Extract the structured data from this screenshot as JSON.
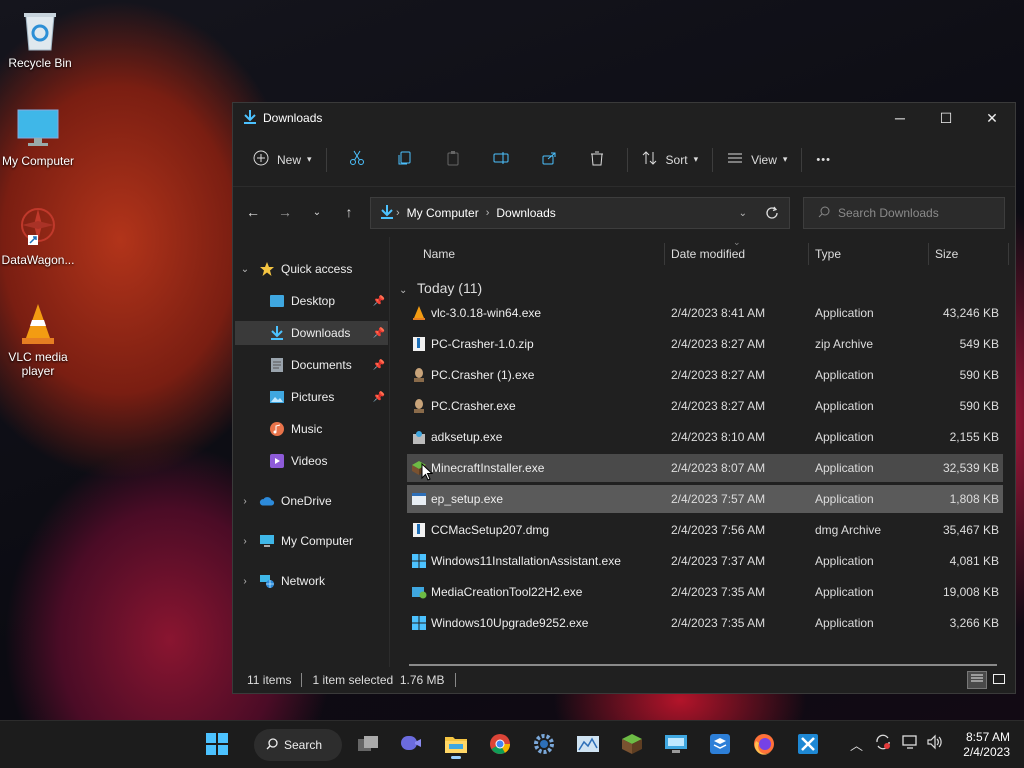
{
  "desktop": {
    "icons": [
      {
        "label": "Recycle Bin",
        "icon": "recycle-bin-icon"
      },
      {
        "label": "My Computer",
        "icon": "monitor-icon"
      },
      {
        "label": "DataWagon...",
        "icon": "datawagon-shortcut-icon"
      },
      {
        "label": "VLC media player",
        "icon": "vlc-cone-icon"
      }
    ]
  },
  "window": {
    "title": "Downloads",
    "controls": {
      "minimize": "─",
      "maximize": "☐",
      "close": "✕"
    },
    "commandbar": {
      "new_label": "New",
      "sort_label": "Sort",
      "view_label": "View",
      "more_label": "•••"
    },
    "address": {
      "crumbs": [
        "My Computer",
        "Downloads"
      ]
    },
    "search": {
      "placeholder": "Search Downloads"
    },
    "sidebar": {
      "quick_access": "Quick access",
      "items": [
        {
          "label": "Desktop",
          "pinned": true
        },
        {
          "label": "Downloads",
          "pinned": true
        },
        {
          "label": "Documents",
          "pinned": true
        },
        {
          "label": "Pictures",
          "pinned": true
        },
        {
          "label": "Music",
          "pinned": false
        },
        {
          "label": "Videos",
          "pinned": false
        }
      ],
      "roots": [
        "OneDrive",
        "My Computer",
        "Network"
      ]
    },
    "columns": {
      "name": "Name",
      "date": "Date modified",
      "type": "Type",
      "size": "Size"
    },
    "group_label": "Today (11)",
    "files": [
      {
        "name": "vlc-3.0.18-win64.exe",
        "date": "2/4/2023 8:41 AM",
        "type": "Application",
        "size": "43,246 KB",
        "icon": "vlc-icon"
      },
      {
        "name": "PC-Crasher-1.0.zip",
        "date": "2/4/2023 8:27 AM",
        "type": "zip Archive",
        "size": "549 KB",
        "icon": "zip-icon"
      },
      {
        "name": "PC.Crasher (1).exe",
        "date": "2/4/2023 8:27 AM",
        "type": "Application",
        "size": "590 KB",
        "icon": "crasher-icon"
      },
      {
        "name": "PC.Crasher.exe",
        "date": "2/4/2023 8:27 AM",
        "type": "Application",
        "size": "590 KB",
        "icon": "crasher-icon"
      },
      {
        "name": "adksetup.exe",
        "date": "2/4/2023 8:10 AM",
        "type": "Application",
        "size": "2,155 KB",
        "icon": "installer-icon"
      },
      {
        "name": "MinecraftInstaller.exe",
        "date": "2/4/2023 8:07 AM",
        "type": "Application",
        "size": "32,539 KB",
        "icon": "minecraft-icon"
      },
      {
        "name": "ep_setup.exe",
        "date": "2/4/2023 7:57 AM",
        "type": "Application",
        "size": "1,808 KB",
        "icon": "exe-icon"
      },
      {
        "name": "CCMacSetup207.dmg",
        "date": "2/4/2023 7:56 AM",
        "type": "dmg Archive",
        "size": "35,467 KB",
        "icon": "dmg-icon"
      },
      {
        "name": "Windows11InstallationAssistant.exe",
        "date": "2/4/2023 7:37 AM",
        "type": "Application",
        "size": "4,081 KB",
        "icon": "windows-icon"
      },
      {
        "name": "MediaCreationTool22H2.exe",
        "date": "2/4/2023 7:35 AM",
        "type": "Application",
        "size": "19,008 KB",
        "icon": "media-tool-icon"
      },
      {
        "name": "Windows10Upgrade9252.exe",
        "date": "2/4/2023 7:35 AM",
        "type": "Application",
        "size": "3,266 KB",
        "icon": "windows-icon"
      }
    ],
    "status": {
      "count": "11 items",
      "selection": "1 item selected  1.76 MB"
    }
  },
  "taskbar": {
    "search_label": "Search",
    "time": "8:57 AM",
    "date": "2/4/2023"
  },
  "colors": {
    "accent": "#4cc2ff",
    "window_bg": "#202020",
    "selected_row": "#5a5a5a"
  }
}
